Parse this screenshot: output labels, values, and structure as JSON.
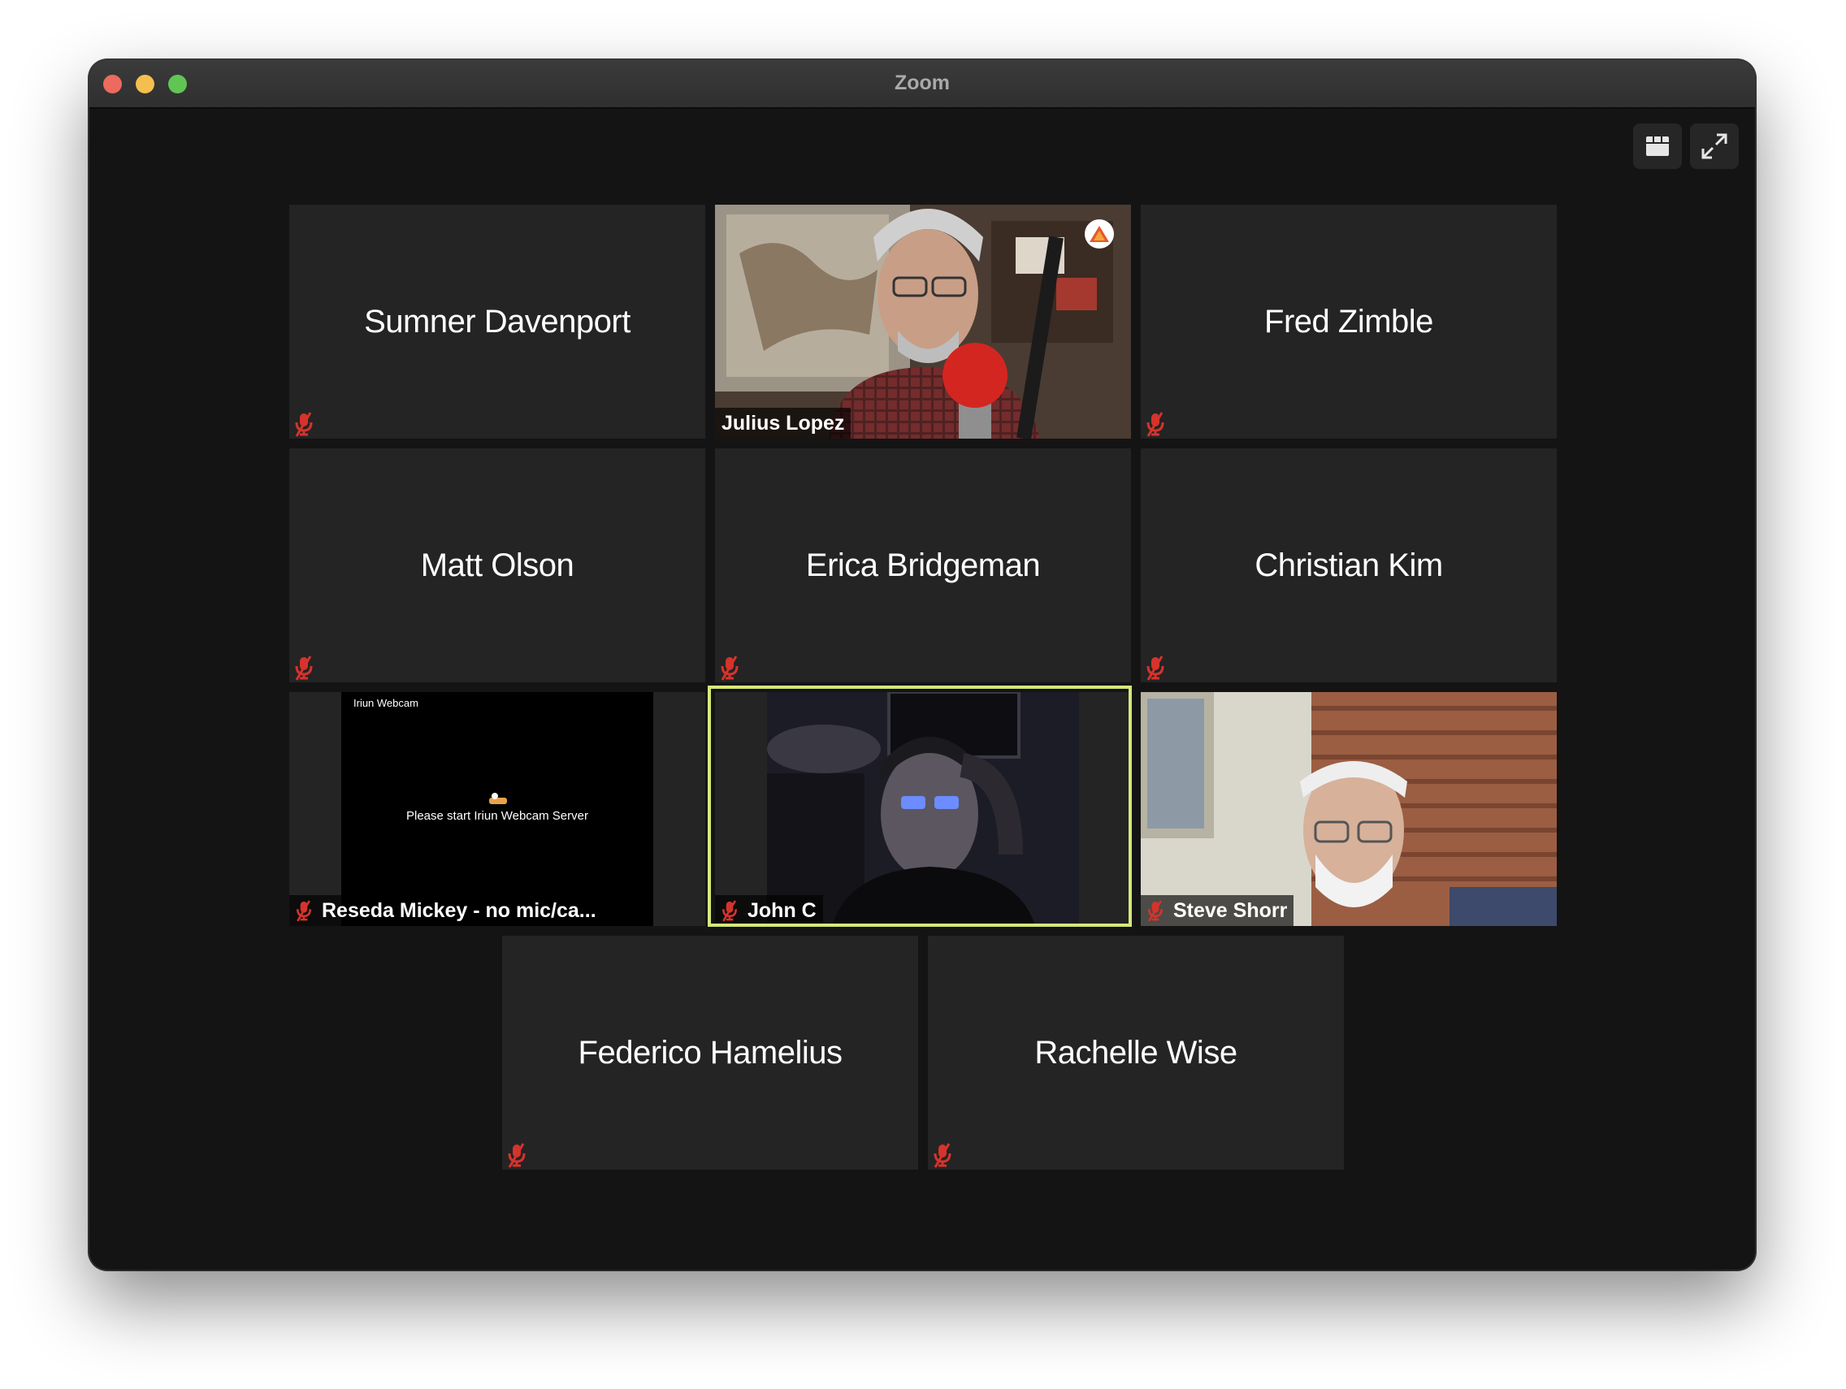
{
  "window": {
    "title": "Zoom",
    "controls": [
      "close",
      "minimize",
      "maximize"
    ]
  },
  "toolbar": {
    "view_button_icon": "grid-icon",
    "fullscreen_button_icon": "expand-icon"
  },
  "participants": [
    {
      "name": "Sumner Davenport",
      "video": false,
      "muted": true
    },
    {
      "name": "Julius Lopez",
      "video": true,
      "muted": false,
      "badge": "warning-icon"
    },
    {
      "name": "Fred Zimble",
      "video": false,
      "muted": true
    },
    {
      "name": "Matt Olson",
      "video": false,
      "muted": true
    },
    {
      "name": "Erica Bridgeman",
      "video": false,
      "muted": true
    },
    {
      "name": "Christian Kim",
      "video": false,
      "muted": true
    },
    {
      "name": "Reseda Mickey - no mic/ca...",
      "video": true,
      "muted": true,
      "video_title": "Iriun Webcam",
      "video_message": "Please start Iriun Webcam Server"
    },
    {
      "name": "John C",
      "video": true,
      "muted": true,
      "active_speaker": true
    },
    {
      "name": "Steve Shorr",
      "video": true,
      "muted": true
    },
    {
      "name": "Federico Hamelius",
      "video": false,
      "muted": true
    },
    {
      "name": "Rachelle Wise",
      "video": false,
      "muted": true
    }
  ],
  "colors": {
    "window_bg": "#141414",
    "tile_bg": "#242424",
    "active_speaker_border": "#d6e87a",
    "muted_icon": "#d6332c"
  }
}
